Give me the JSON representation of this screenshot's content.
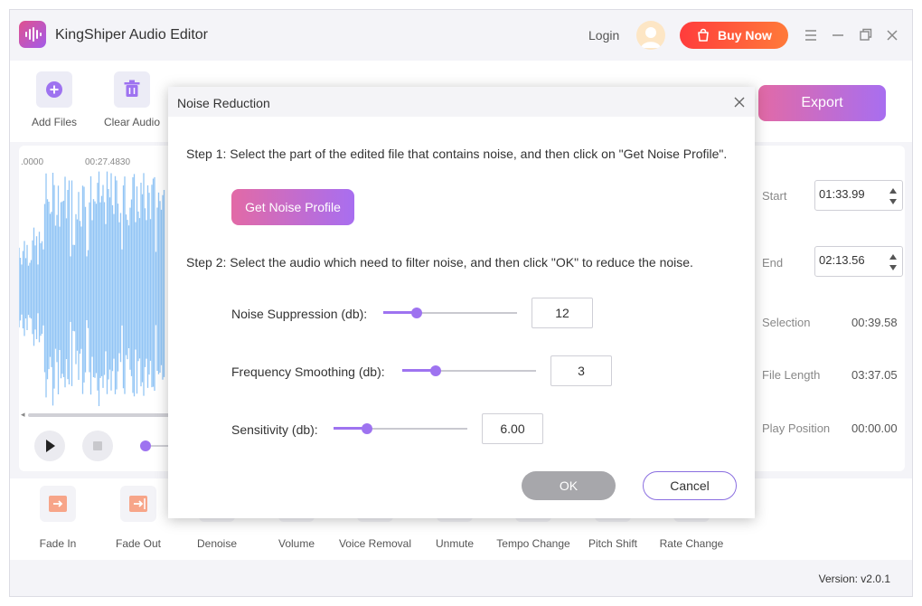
{
  "app": {
    "title": "KingShiper Audio Editor",
    "login_label": "Login",
    "buy_label": "Buy Now",
    "version": "Version: v2.0.1",
    "accent": "#9e73f0"
  },
  "toolbar": {
    "add_files": "Add Files",
    "clear_audio": "Clear Audio",
    "export_label": "Export"
  },
  "waveform": {
    "time_start": ".0000",
    "time_mark": "00:27.4830"
  },
  "info": {
    "start_label": "Start",
    "start_value": "01:33.99",
    "end_label": "End",
    "end_value": "02:13.56",
    "selection_label": "Selection",
    "selection_value": "00:39.58",
    "file_length_label": "File Length",
    "file_length_value": "03:37.05",
    "play_position_label": "Play Position",
    "play_position_value": "00:00.00"
  },
  "effects": [
    {
      "label": "Fade In"
    },
    {
      "label": "Fade Out"
    },
    {
      "label": "Denoise"
    },
    {
      "label": "Volume"
    },
    {
      "label": "Voice Removal"
    },
    {
      "label": "Unmute"
    },
    {
      "label": "Tempo Change"
    },
    {
      "label": "Pitch Shift"
    },
    {
      "label": "Rate Change"
    }
  ],
  "dialog": {
    "title": "Noise Reduction",
    "step1": "Step 1:  Select the part of the edited file that contains noise, and then click on \"Get Noise Profile\".",
    "get_profile_label": "Get Noise Profile",
    "step2": "Step 2:  Select the audio which need to filter noise, and then click \"OK\" to reduce the noise.",
    "params": [
      {
        "label": "Noise Suppression (db):",
        "value": "12",
        "level": 0.25
      },
      {
        "label": "Frequency Smoothing (db):",
        "value": "3",
        "level": 0.25
      },
      {
        "label": "Sensitivity (db):",
        "value": "6.00",
        "level": 0.25
      }
    ],
    "ok_label": "OK",
    "cancel_label": "Cancel"
  }
}
